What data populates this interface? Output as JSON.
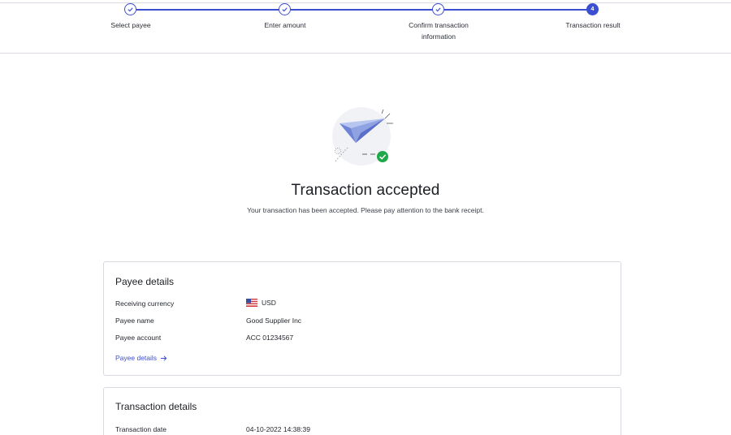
{
  "stepper": {
    "steps": [
      {
        "label": "Select payee",
        "state": "done"
      },
      {
        "label": "Enter amount",
        "state": "done"
      },
      {
        "label": "Confirm transaction information",
        "state": "done"
      },
      {
        "label": "Transaction result",
        "state": "current",
        "number": "4"
      }
    ]
  },
  "result": {
    "title": "Transaction accepted",
    "message": "Your transaction has been accepted. Please pay attention to the bank receipt."
  },
  "payee_card": {
    "title": "Payee details",
    "rows": [
      {
        "label": "Receiving currency",
        "value": "USD",
        "icon": "us-flag-icon"
      },
      {
        "label": "Payee name",
        "value": "Good Supplier Inc"
      },
      {
        "label": "Payee account",
        "value": "ACC 01234567"
      }
    ],
    "link_label": "Payee details"
  },
  "transaction_card": {
    "title": "Transaction details",
    "rows": [
      {
        "label": "Transaction date",
        "value": "04-10-2022 14:38:39"
      }
    ]
  },
  "colors": {
    "accent": "#3d4fd1",
    "success": "#1fa84a",
    "border": "#d6d9df"
  }
}
